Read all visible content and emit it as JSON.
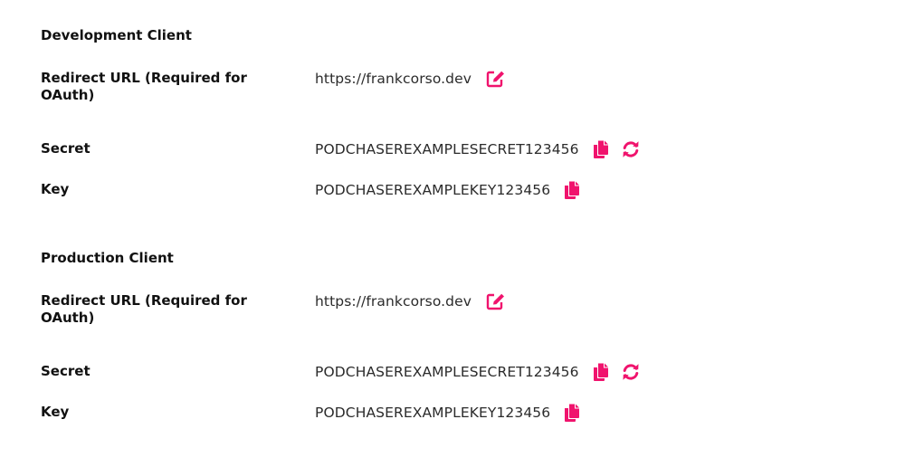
{
  "accent_color": "#f0136d",
  "clients": [
    {
      "title": "Development Client",
      "redirect": {
        "label": "Redirect URL (Required for OAuth)",
        "value": "https://frankcorso.dev",
        "icon": "edit-icon"
      },
      "secret": {
        "label": "Secret",
        "value": "PODCHASEREXAMPLESECRET123456",
        "icons": [
          "copy-icon",
          "refresh-icon"
        ]
      },
      "key": {
        "label": "Key",
        "value": "PODCHASEREXAMPLEKEY123456",
        "icon": "copy-icon"
      }
    },
    {
      "title": "Production Client",
      "redirect": {
        "label": "Redirect URL (Required for OAuth)",
        "value": "https://frankcorso.dev",
        "icon": "edit-icon"
      },
      "secret": {
        "label": "Secret",
        "value": "PODCHASEREXAMPLESECRET123456",
        "icons": [
          "copy-icon",
          "refresh-icon"
        ]
      },
      "key": {
        "label": "Key",
        "value": "PODCHASEREXAMPLEKEY123456",
        "icon": "copy-icon"
      }
    }
  ]
}
